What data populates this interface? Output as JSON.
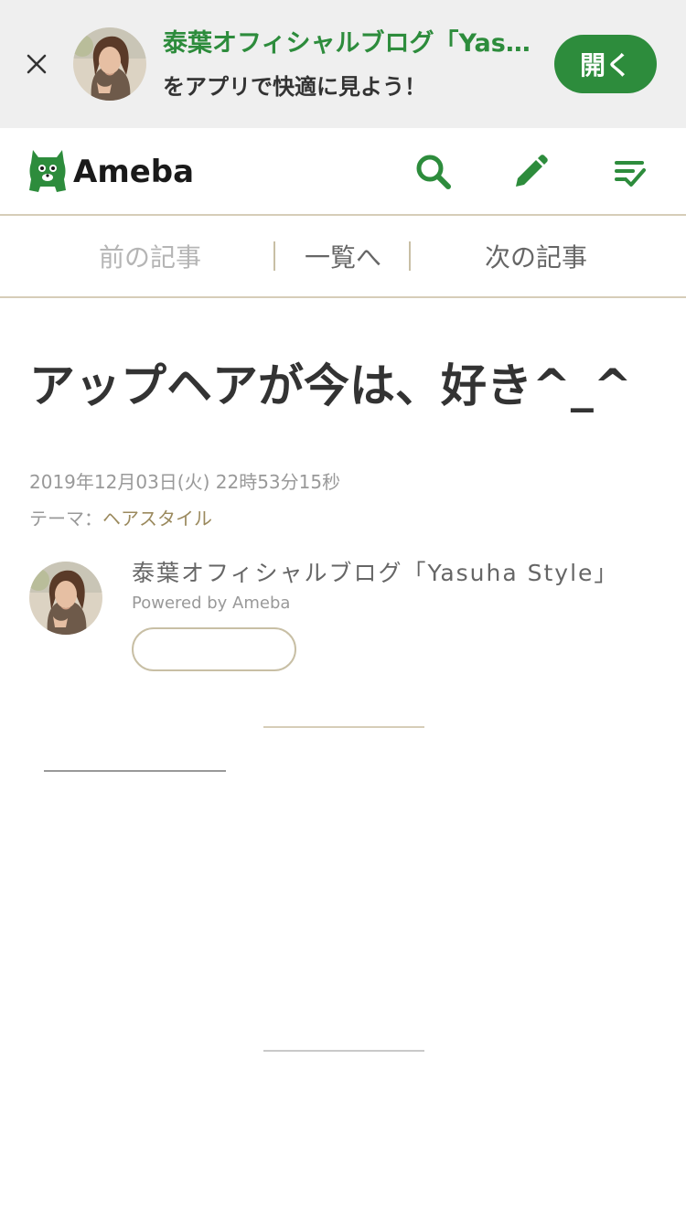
{
  "app_banner": {
    "title": "泰葉オフィシャルブログ「Yasuha Style」",
    "subtitle": "をアプリで快適に見よう！",
    "open_label": "開く"
  },
  "header": {
    "logo_text": "Ameba",
    "icons": [
      "search-icon",
      "pencil-icon",
      "feed-check-icon"
    ]
  },
  "article_nav": {
    "prev_label": "前の記事",
    "list_label": "一覧へ",
    "next_label": "次の記事"
  },
  "article": {
    "title": "アップヘアが今は、好き^_^",
    "date": "2019年12月03日(火) 22時53分15秒",
    "theme_prefix": "テーマ：",
    "theme_link": "ヘアスタイル"
  },
  "author": {
    "blog_name": "泰葉オフィシャルブログ「Yasuha Style」",
    "powered_by": "Powered by Ameba",
    "follow_label": ""
  },
  "colors": {
    "brand_green": "#2d8c3c",
    "banner_bg": "#efefef",
    "accent_beige": "#d6cdb8",
    "theme_link": "#9b8a5e"
  }
}
